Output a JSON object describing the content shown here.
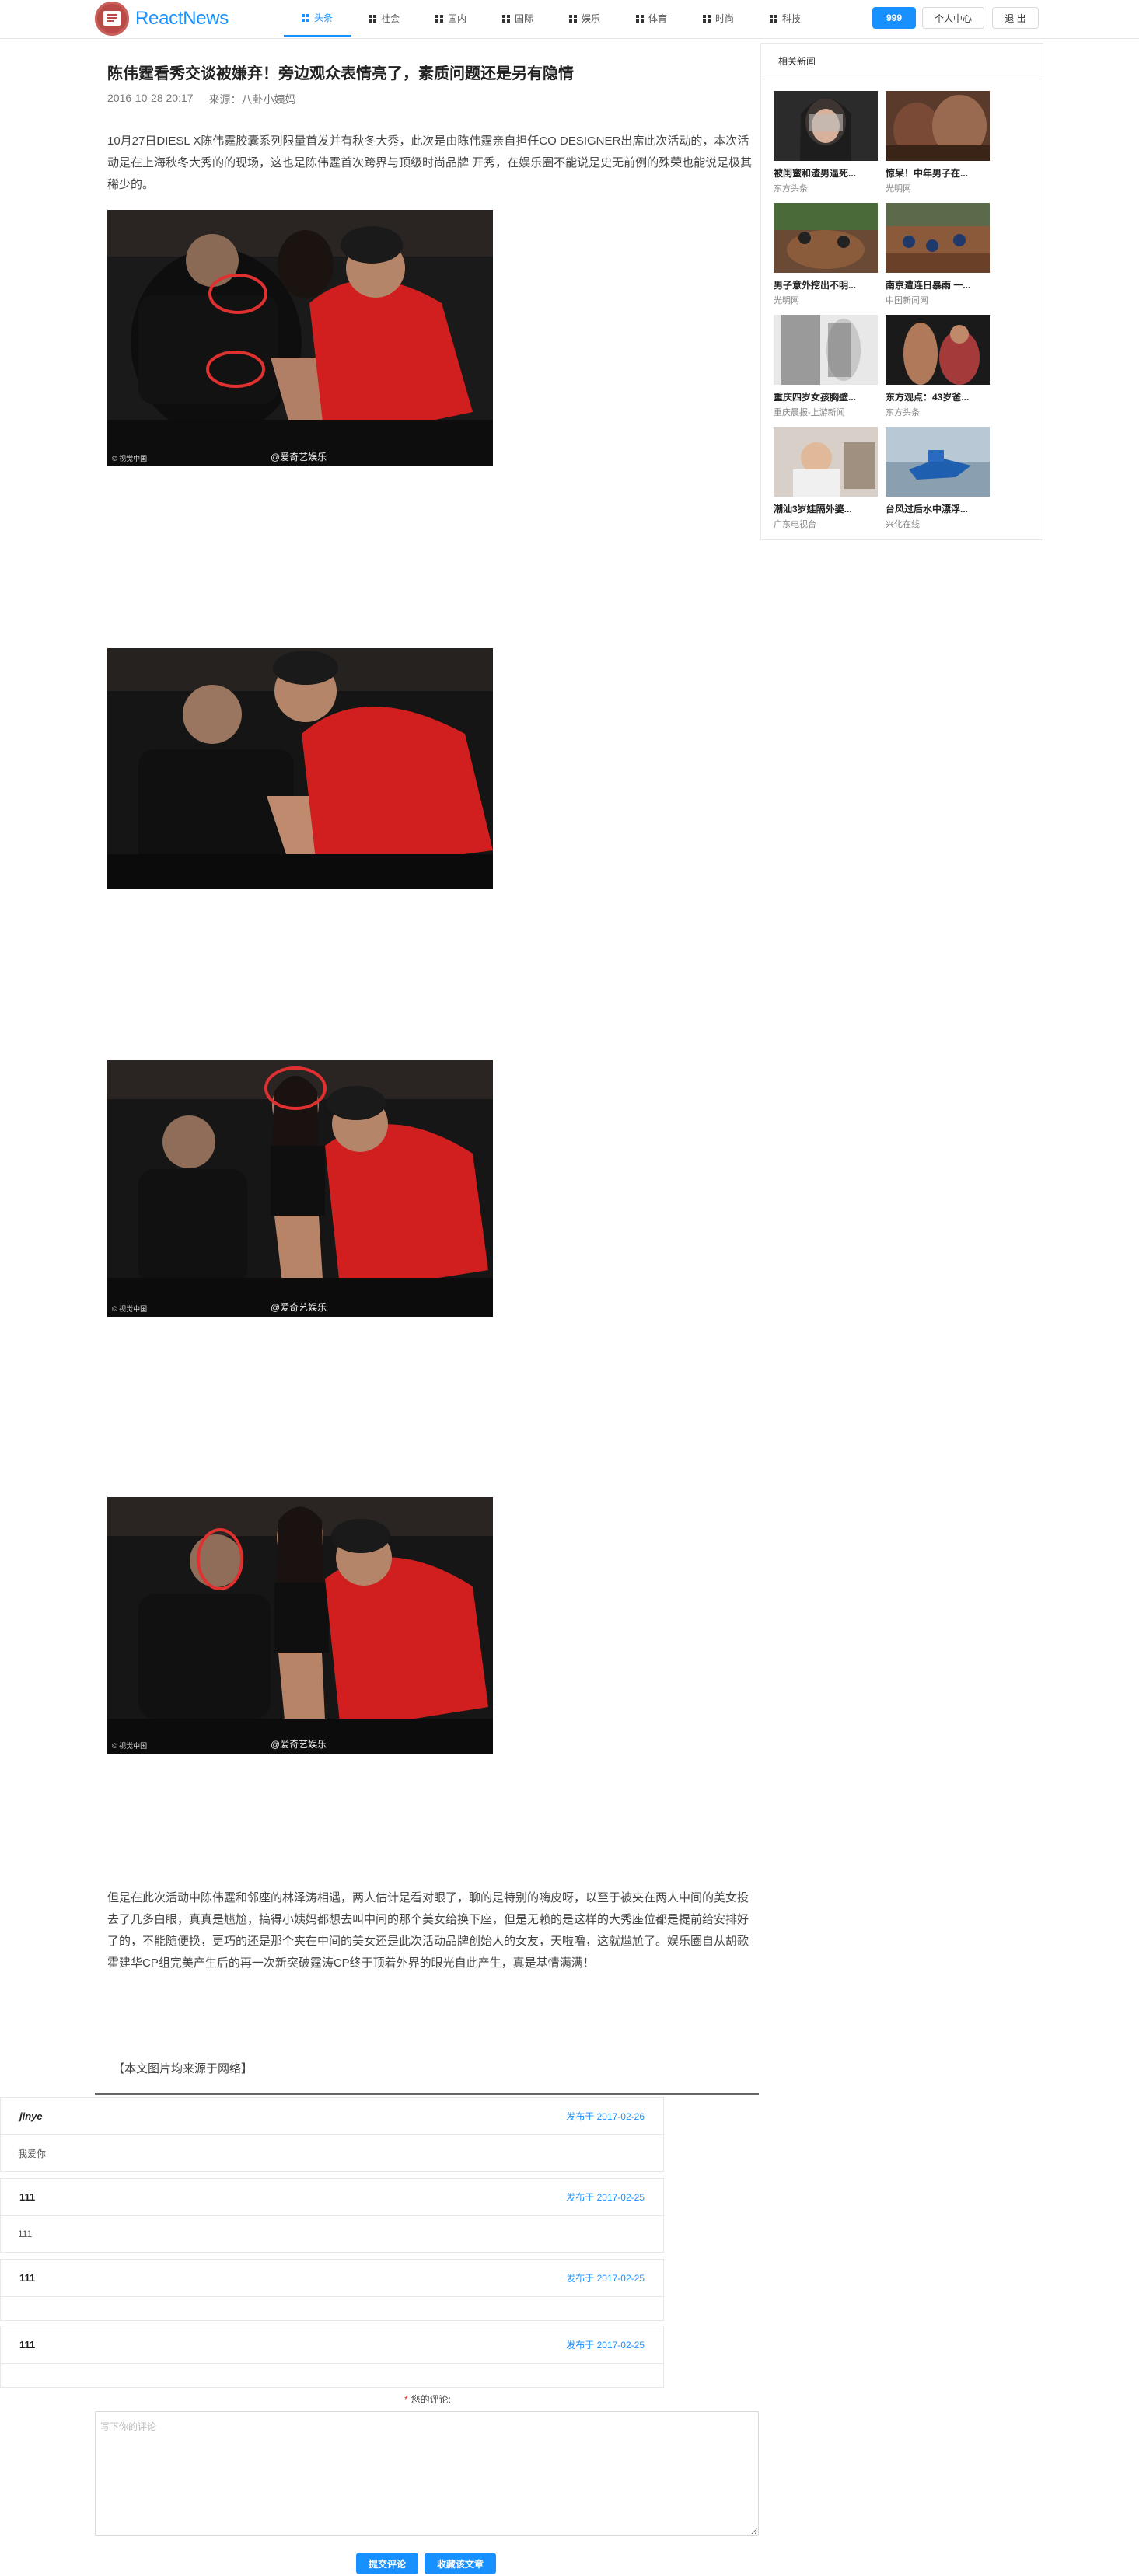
{
  "app": {
    "brand": "ReactNews"
  },
  "nav": {
    "items": [
      {
        "label": "头条",
        "icon": "grid-icon",
        "active": true
      },
      {
        "label": "社会",
        "icon": "grid-icon",
        "active": false
      },
      {
        "label": "国内",
        "icon": "grid-icon",
        "active": false
      },
      {
        "label": "国际",
        "icon": "grid-icon",
        "active": false
      },
      {
        "label": "娱乐",
        "icon": "grid-icon",
        "active": false
      },
      {
        "label": "体育",
        "icon": "grid-icon",
        "active": false
      },
      {
        "label": "时尚",
        "icon": "grid-icon",
        "active": false
      },
      {
        "label": "科技",
        "icon": "grid-icon",
        "active": false
      }
    ],
    "count_badge": "999",
    "user_center": "个人中心",
    "logout": "退 出"
  },
  "article": {
    "title": "陈伟霆看秀交谈被嫌弃！旁边观众表情亮了，素质问题还是另有隐情",
    "date": "2016-10-28 20:17",
    "source": "来源：八卦小姨妈",
    "paragraph_1": "10月27日DIESL X陈伟霆胶囊系列限量首发并有秋冬大秀，此次是由陈伟霆亲自担任CO DESIGNER出席此次活动的，本次活动是在上海秋冬大秀的的现场，这也是陈伟霆首次跨界与顶级时尚品牌 开秀，在娱乐圈不能说是史无前例的殊荣也能说是极其稀少的。",
    "photos": [
      {
        "caption_left": "© 视觉中国",
        "caption_center": "@爱奇艺娱乐"
      },
      {
        "caption_left": "",
        "caption_center": ""
      },
      {
        "caption_left": "© 视觉中国",
        "caption_center": "@爱奇艺娱乐"
      },
      {
        "caption_left": "© 视觉中国",
        "caption_center": "@爱奇艺娱乐"
      }
    ],
    "paragraph_2": "但是在此次活动中陈伟霆和邻座的林泽涛相遇，两人估计是看对眼了，聊的是特别的嗨皮呀，以至于被夹在两人中间的美女投去了几多白眼，真真是尴尬，搞得小姨妈都想去叫中间的那个美女给换下座，但是无赖的是这样的大秀座位都是提前给安排好了的，不能随便换，更巧的还是那个夹在中间的美女还是此次活动品牌创始人的女友，天啦噜，这就尴尬了。娱乐圈自从胡歌霍建华CP组完美产生后的再一次新突破霆涛CP终于顶着外界的眼光自此产生，真是基情满满！",
    "note": "【本文图片均来源于网络】"
  },
  "sidebar": {
    "title": "相关新闻",
    "items": [
      {
        "title": "被闺蜜和渣男逼死...",
        "source": "东方头条"
      },
      {
        "title": "惊呆！中年男子在...",
        "source": "光明网"
      },
      {
        "title": "男子意外挖出不明...",
        "source": "光明网"
      },
      {
        "title": "南京遭连日暴雨 一...",
        "source": "中国新闻网"
      },
      {
        "title": "重庆四岁女孩胸壁...",
        "source": "重庆晨报-上游新闻"
      },
      {
        "title": "东方观点：43岁爸...",
        "source": "东方头条"
      },
      {
        "title": "潮汕3岁娃隔外婆...",
        "source": "广东电视台"
      },
      {
        "title": "台风过后水中漂浮...",
        "source": "兴化在线"
      }
    ]
  },
  "comments": [
    {
      "author": "jinye",
      "date": "发布于 2017-02-26",
      "text": "我爱你"
    },
    {
      "author": "111",
      "date": "发布于 2017-02-25",
      "text": "111"
    },
    {
      "author": "111",
      "date": "发布于 2017-02-25",
      "text": ""
    },
    {
      "author": "111",
      "date": "发布于 2017-02-25",
      "text": ""
    }
  ],
  "comment_form": {
    "label": "您的评论:",
    "placeholder": "写下你的评论",
    "submit": "提交评论",
    "favorite": "收藏该文章"
  },
  "colors": {
    "accent": "#1890ff",
    "logo": "#b94a48"
  }
}
